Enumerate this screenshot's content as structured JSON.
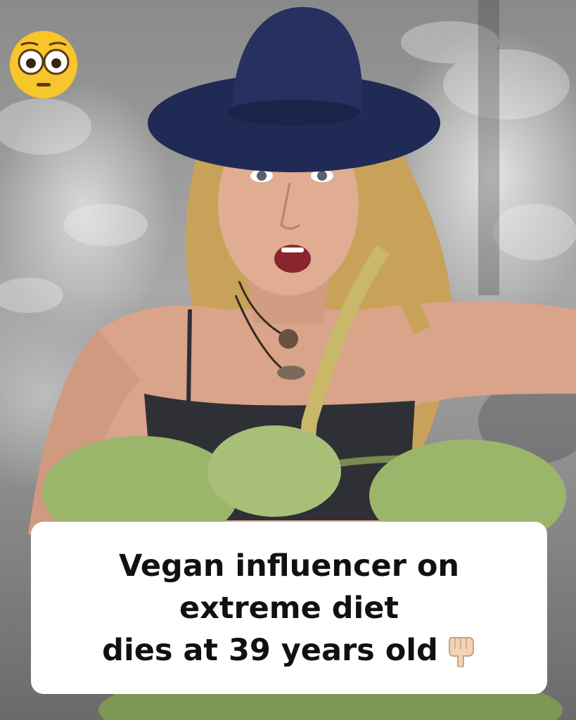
{
  "image": {
    "alt_subject": "woman in blue hat holding green coconuts",
    "emoji_top_left": "flushed-face-emoji"
  },
  "caption": {
    "line1": "Vegan influencer on",
    "line2": "extreme diet",
    "line3": "dies at 39 years old",
    "trailing_emoji": "pointing-down-hand-emoji"
  },
  "colors": {
    "hat": "#1f2a55",
    "coconut": "#9bb56b",
    "hair": "#c9a25a",
    "skin": "#d9a48a",
    "caption_bg": "#ffffff",
    "caption_text": "#111111"
  }
}
